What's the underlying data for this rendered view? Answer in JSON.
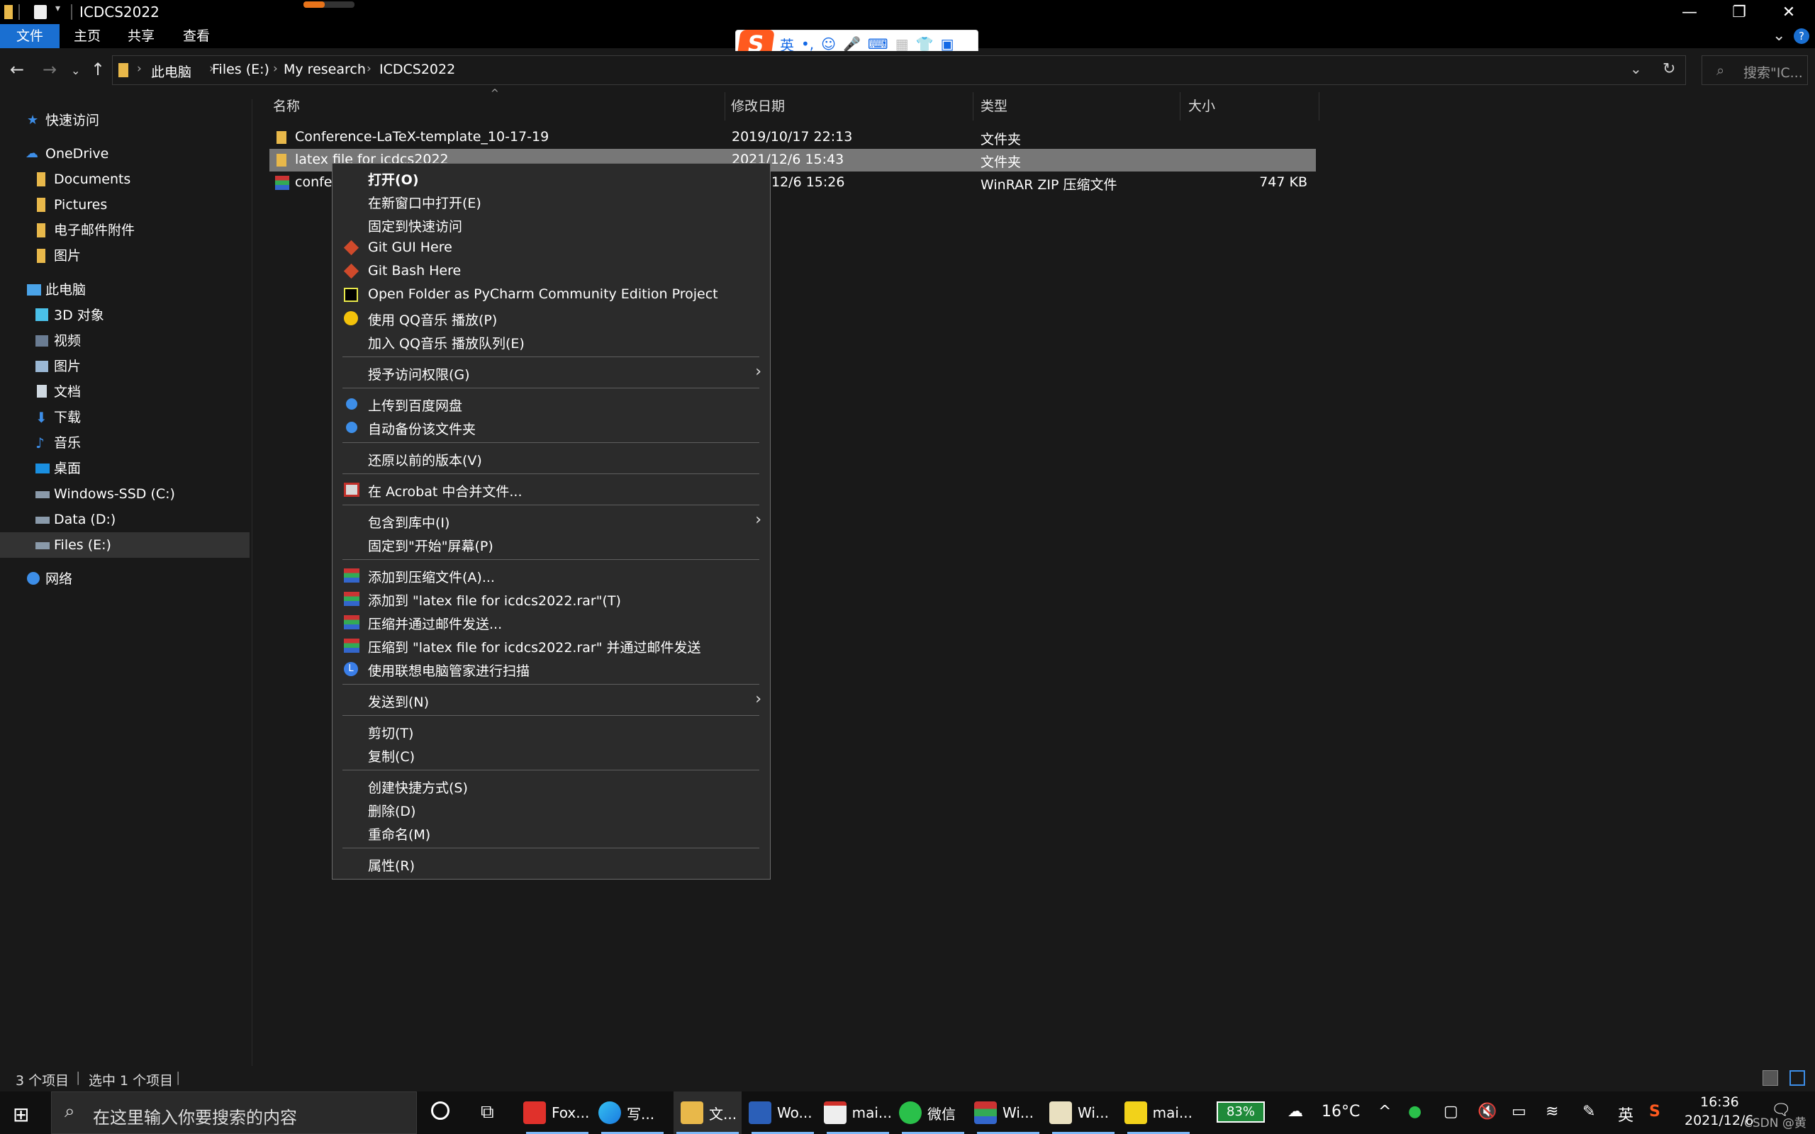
{
  "window": {
    "title": "ICDCS2022"
  },
  "ribbon": {
    "tabs": [
      "文件",
      "主页",
      "共享",
      "查看"
    ]
  },
  "ime": {
    "lang": "英",
    "punct": "•,"
  },
  "address": {
    "crumbs": [
      "此电脑",
      "Files (E:)",
      "My research",
      "ICDCS2022"
    ],
    "search_placeholder": "搜索\"IC..."
  },
  "sidebar": {
    "items": [
      {
        "label": "快速访问",
        "icon": "star-icon"
      },
      {
        "label": "OneDrive",
        "icon": "cloud-icon"
      },
      {
        "label": "Documents",
        "icon": "folder-icon"
      },
      {
        "label": "Pictures",
        "icon": "folder-icon"
      },
      {
        "label": "电子邮件附件",
        "icon": "folder-icon"
      },
      {
        "label": "图片",
        "icon": "folder-icon"
      },
      {
        "label": "此电脑",
        "icon": "computer-icon"
      },
      {
        "label": "3D 对象",
        "icon": "cube-icon"
      },
      {
        "label": "视频",
        "icon": "video-icon"
      },
      {
        "label": "图片",
        "icon": "picture-icon"
      },
      {
        "label": "文档",
        "icon": "document-icon"
      },
      {
        "label": "下载",
        "icon": "download-icon"
      },
      {
        "label": "音乐",
        "icon": "music-icon"
      },
      {
        "label": "桌面",
        "icon": "desktop-icon"
      },
      {
        "label": "Windows-SSD (C:)",
        "icon": "drive-icon"
      },
      {
        "label": "Data (D:)",
        "icon": "drive-icon"
      },
      {
        "label": "Files (E:)",
        "icon": "drive-icon"
      },
      {
        "label": "网络",
        "icon": "network-icon"
      }
    ]
  },
  "columns": {
    "name": "名称",
    "modified": "修改日期",
    "type": "类型",
    "size": "大小"
  },
  "files": [
    {
      "name": "Conference-LaTeX-template_10-17-19",
      "modified": "2019/10/17 22:13",
      "type": "文件夹",
      "size": ""
    },
    {
      "name": "latex file for icdcs2022",
      "modified": "2021/12/6 15:43",
      "type": "文件夹",
      "size": ""
    },
    {
      "name": "confer",
      "modified": "12/6 15:26",
      "type": "WinRAR ZIP 压缩文件",
      "size": "747 KB"
    }
  ],
  "context_menu": {
    "groups": [
      [
        "打开(O)",
        "在新窗口中打开(E)",
        "固定到快速访问",
        "Git GUI Here",
        "Git Bash Here",
        "Open Folder as PyCharm Community Edition Project",
        "使用 QQ音乐 播放(P)",
        "加入 QQ音乐 播放队列(E)"
      ],
      [
        "授予访问权限(G)"
      ],
      [
        "上传到百度网盘",
        "自动备份该文件夹"
      ],
      [
        "还原以前的版本(V)"
      ],
      [
        "在 Acrobat 中合并文件..."
      ],
      [
        "包含到库中(I)",
        "固定到\"开始\"屏幕(P)"
      ],
      [
        "添加到压缩文件(A)...",
        "添加到 \"latex file for icdcs2022.rar\"(T)",
        "压缩并通过邮件发送...",
        "压缩到 \"latex file for icdcs2022.rar\" 并通过邮件发送",
        "使用联想电脑管家进行扫描"
      ],
      [
        "发送到(N)"
      ],
      [
        "剪切(T)",
        "复制(C)"
      ],
      [
        "创建快捷方式(S)",
        "删除(D)",
        "重命名(M)"
      ],
      [
        "属性(R)"
      ]
    ]
  },
  "status": {
    "count": "3 个项目",
    "selected": "选中 1 个项目"
  },
  "taskbar": {
    "search_placeholder": "在这里输入你要搜索的内容",
    "apps": [
      "Fox...",
      "写...",
      "文...",
      "Wo...",
      "mai...",
      "微信",
      "Wi...",
      "Wi...",
      "mai..."
    ],
    "battery": "83%",
    "weather": "16°C",
    "ime": "英",
    "time": "16:36",
    "date": "2021/12/6",
    "watermark": "CSDN @黄翎鸣"
  },
  "colors": {
    "accent": "#1a6fd1",
    "folder": "#e8b84a",
    "menu_bg": "#2b2b2b"
  }
}
